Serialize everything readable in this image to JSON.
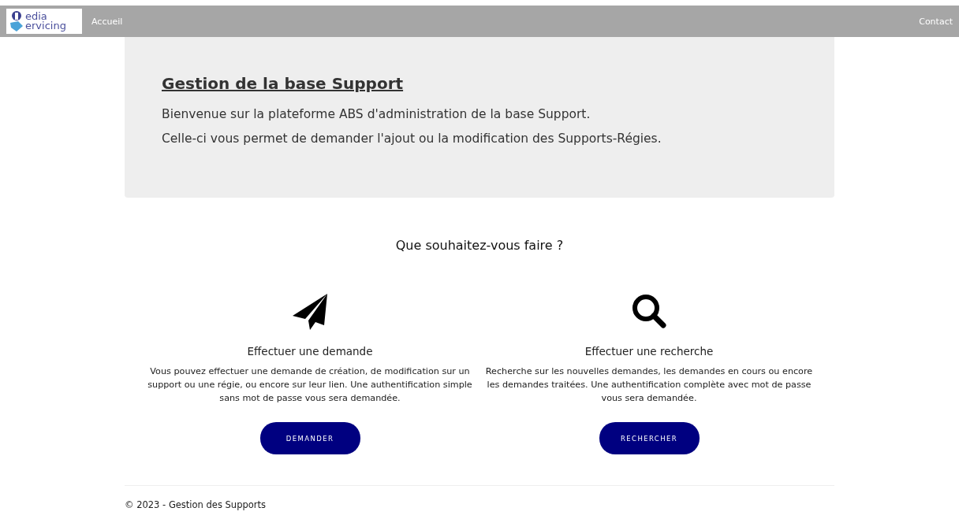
{
  "navbar": {
    "logo": {
      "line1": "edia",
      "line2": "ervicing"
    },
    "links": [
      "Accueil"
    ],
    "right_link": "Contact"
  },
  "banner": {
    "title": "Gestion de la base Support",
    "paragraphs": [
      "Bienvenue sur la plateforme ABS d'administration de la base Support.",
      "Celle-ci vous permet de demander l'ajout ou la modification des Supports-Régies."
    ]
  },
  "question": "Que souhaitez-vous faire ?",
  "actions": [
    {
      "kind": "send",
      "title": "Effectuer une demande",
      "text": "Vous pouvez effectuer une demande de création, de modification sur un support ou une régie, ou encore sur leur lien. Une authentification simple sans mot de passe vous sera demandée.",
      "button": "DEMANDER"
    },
    {
      "kind": "search",
      "title": "Effectuer une recherche",
      "text": "Recherche sur les nouvelles demandes, les demandes en cours ou encore les demandes traitées. Une authentification complète avec mot de passe vous sera demandée.",
      "button": "RECHERCHER"
    }
  ],
  "footer": "© 2023 - Gestion des Supports"
}
